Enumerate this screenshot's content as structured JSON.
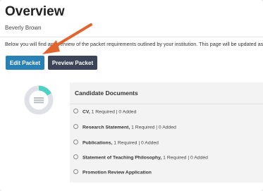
{
  "header": {
    "title": "Overview",
    "user_name": "Beverly Brown"
  },
  "intro": {
    "text": "Below you will find an overview of the packet requirements outlined by your institution. This page will be updated as"
  },
  "buttons": {
    "edit_label": "Edit Packet",
    "preview_label": "Preview Packet"
  },
  "progress": {
    "fraction_complete": 0.17
  },
  "documents": {
    "heading": "Candidate Documents",
    "items": [
      {
        "name": "CV,",
        "detail": " 1 Required | 0 Added"
      },
      {
        "name": "Research Statement,",
        "detail": " 1 Required | 0 Added"
      },
      {
        "name": "Publications,",
        "detail": " 1 Required | 0 Added"
      },
      {
        "name": "Statement of Teaching Philosophy,",
        "detail": " 1 Required | 0 Added"
      },
      {
        "name": "Promotion Review Application",
        "detail": ""
      }
    ]
  },
  "colors": {
    "primary_button": "#2a81b5",
    "secondary_button": "#3b4557",
    "annotation_arrow": "#e0652e",
    "progress_fill": "#4fd1c5",
    "progress_track": "#dfe1e6"
  }
}
